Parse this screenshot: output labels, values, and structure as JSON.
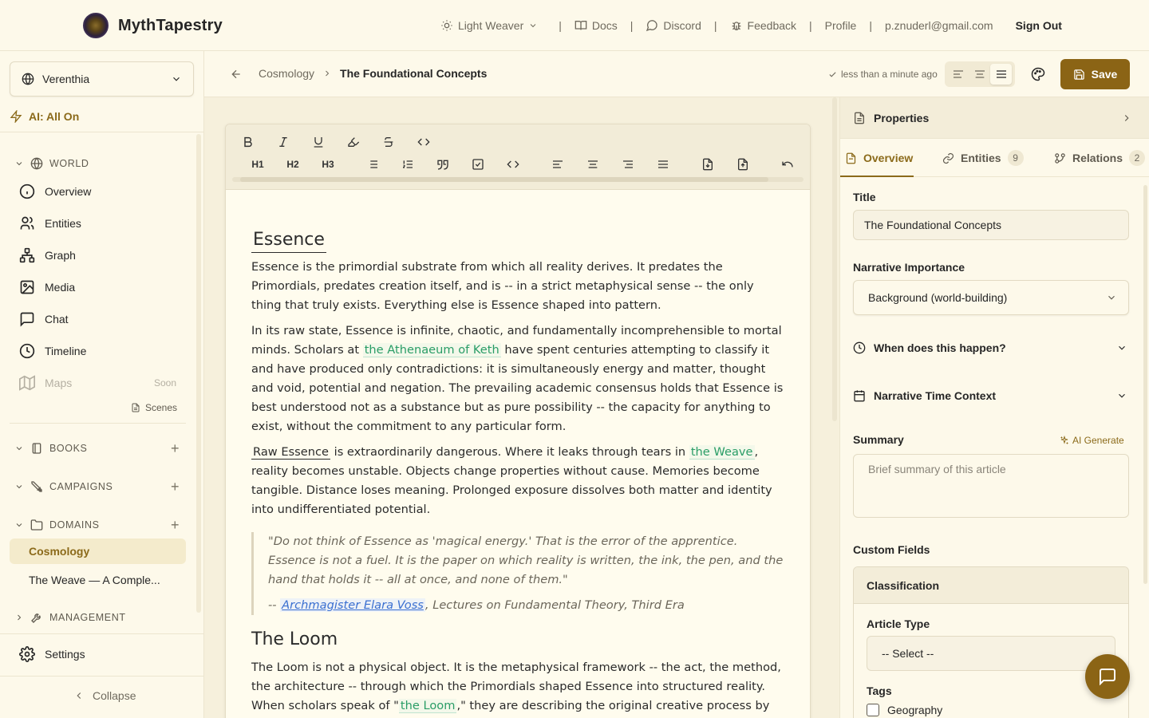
{
  "app": {
    "name": "MythTapestry"
  },
  "topnav": {
    "theme_label": "Light Weaver",
    "docs": "Docs",
    "discord": "Discord",
    "feedback": "Feedback",
    "profile": "Profile",
    "email": "p.znuderl@gmail.com",
    "signout": "Sign Out",
    "separator": "|"
  },
  "sidebar": {
    "world_name": "Verenthia",
    "ai_status": "AI: All On",
    "world_section": "WORLD",
    "items": [
      {
        "label": "Overview",
        "icon": "info-icon"
      },
      {
        "label": "Entities",
        "icon": "users-icon"
      },
      {
        "label": "Graph",
        "icon": "graph-icon"
      },
      {
        "label": "Media",
        "icon": "image-icon"
      },
      {
        "label": "Chat",
        "icon": "chat-icon"
      },
      {
        "label": "Timeline",
        "icon": "clock-icon"
      },
      {
        "label": "Maps",
        "icon": "map-icon",
        "badge": "Soon"
      }
    ],
    "scenes": "Scenes",
    "books": "BOOKS",
    "campaigns": "CAMPAIGNS",
    "domains": "DOMAINS",
    "domain_items": [
      "Cosmology",
      "The Weave — A Comple..."
    ],
    "management": "MANAGEMENT",
    "settings": "Settings",
    "collapse": "Collapse"
  },
  "editor_header": {
    "breadcrumb_parent": "Cosmology",
    "breadcrumb_current": "The Foundational Concepts",
    "saved_status": "less than a minute ago",
    "save_label": "Save"
  },
  "toolbar": {
    "h1": "H1",
    "h2": "H2",
    "h3": "H3"
  },
  "document": {
    "heading1": "Essence",
    "p1": "Essence is the primordial substrate from which all reality derives. It predates the Primordials, predates creation itself, and is -- in a strict metaphysical sense -- the only thing that truly exists. Everything else is Essence shaped into pattern.",
    "p2_a": "In its raw state, Essence is infinite, chaotic, and fundamentally incomprehensible to mortal minds. Scholars at ",
    "p2_link": "the Athenaeum of Keth",
    "p2_b": " have spent centuries attempting to classify it and have produced only contradictions: it is simultaneously energy and matter, thought and void, potential and negation. The prevailing academic consensus holds that Essence is best understood not as a substance but as pure possibility -- the capacity for anything to exist, without the commitment to any particular form.",
    "p3_link1": "Raw Essence",
    "p3_a": " is extraordinarily dangerous. Where it leaks through tears in ",
    "p3_link2": "the Weave",
    "p3_b": ", reality becomes unstable. Objects change properties without cause. Memories become tangible. Distance loses meaning. Prolonged exposure dissolves both matter and identity into undifferentiated potential.",
    "quote": "\"Do not think of Essence as 'magical energy.' That is the error of the apprentice. Essence is not a fuel. It is the paper on which reality is written, the ink, the pen, and the hand that holds it -- all at once, and none of them.\"",
    "quote_attr_prefix": "-- ",
    "quote_attr_link": "Archmagister Elara Voss",
    "quote_attr_suffix": ", Lectures on Fundamental Theory, Third Era",
    "heading2": "The Loom",
    "p4_a": "The Loom is not a physical object. It is the metaphysical framework -- the act, the method, the architecture -- through which the Primordials shaped Essence into structured reality. When scholars speak of \"",
    "p4_link": "the Loom",
    "p4_b": ",\" they are describing the original creative process by which"
  },
  "properties": {
    "title": "Properties",
    "tabs": [
      {
        "label": "Overview"
      },
      {
        "label": "Entities",
        "count": "9"
      },
      {
        "label": "Relations",
        "count": "2"
      }
    ],
    "title_label": "Title",
    "title_value": "The Foundational Concepts",
    "importance_label": "Narrative Importance",
    "importance_value": "Background (world-building)",
    "when_label": "When does this happen?",
    "time_context_label": "Narrative Time Context",
    "summary_label": "Summary",
    "ai_generate": "AI Generate",
    "summary_placeholder": "Brief summary of this article",
    "custom_fields_label": "Custom Fields",
    "classification": "Classification",
    "article_type_label": "Article Type",
    "article_type_value": "-- Select --",
    "tags_label": "Tags",
    "tag_option": "Geography"
  },
  "colors": {
    "accent": "#8b6415",
    "background": "#fdf9ea",
    "link_green": "#2a9d66",
    "link_blue": "#3a6fd0"
  }
}
